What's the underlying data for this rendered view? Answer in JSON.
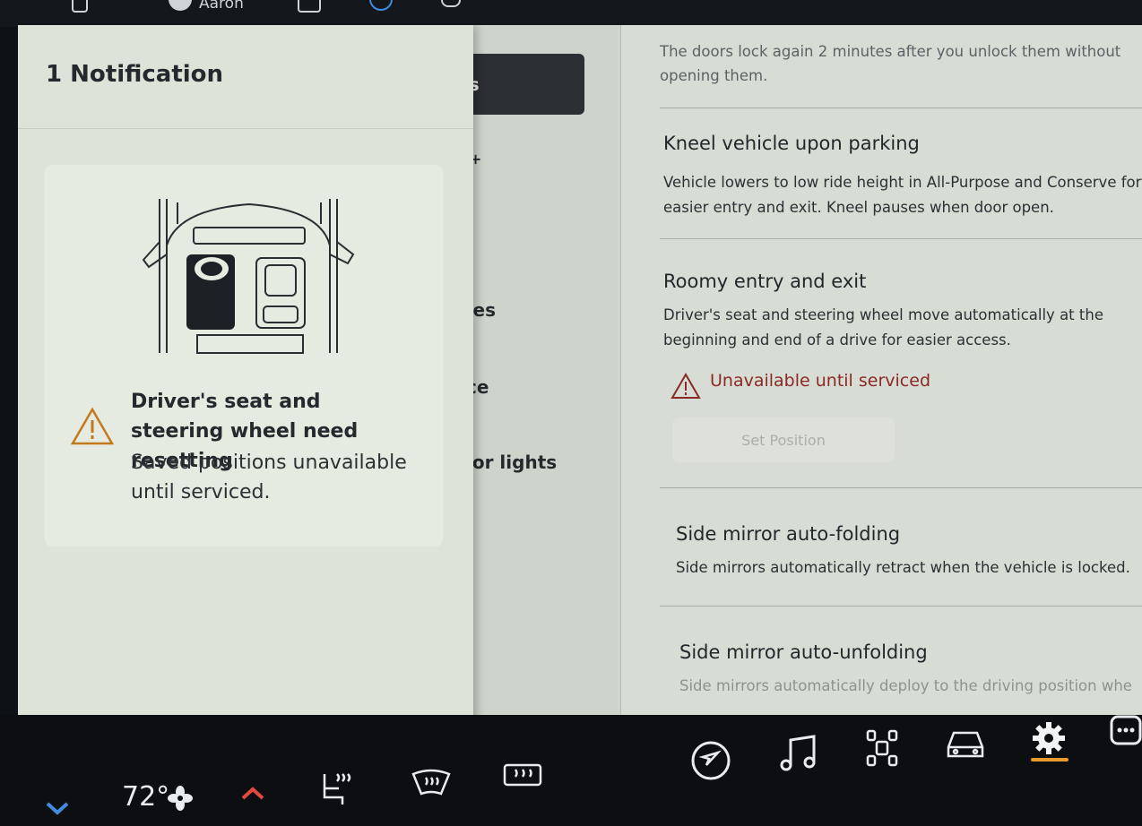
{
  "topbar": {
    "user": "Aaron"
  },
  "middle": {
    "selected_fragment": "ss",
    "items": [
      "r+",
      "tes",
      "ce",
      "ior lights"
    ]
  },
  "right": {
    "top_desc": "The doors lock again 2 minutes after you unlock them without opening them.",
    "kneel": {
      "title": "Kneel vehicle upon parking",
      "desc": "Vehicle lowers to low ride height in All-Purpose and Conserve for easier entry and exit. Kneel pauses when door open."
    },
    "roomy": {
      "title": "Roomy entry and exit",
      "desc": "Driver's seat and steering wheel move automatically at the beginning and end of a drive for easier access.",
      "warning": "Unavailable until serviced",
      "button": "Set Position"
    },
    "fold": {
      "title": "Side mirror auto-folding",
      "desc": "Side mirrors automatically retract when the vehicle is locked."
    },
    "unfold": {
      "title": "Side mirror auto-unfolding",
      "desc": "Side mirrors automatically deploy to the driving position whe"
    }
  },
  "notification": {
    "header": "1 Notification",
    "title": "Driver's seat and steering wheel need resetting",
    "body": "Saved positions unavailable until serviced."
  },
  "dock": {
    "temperature": "72°"
  },
  "colors": {
    "accent": "#e89a2a",
    "warning_text": "#8b2a24",
    "warning_icon": "#c27a1c",
    "chevron_blue": "#3f8be0",
    "chevron_red": "#e0493c"
  }
}
